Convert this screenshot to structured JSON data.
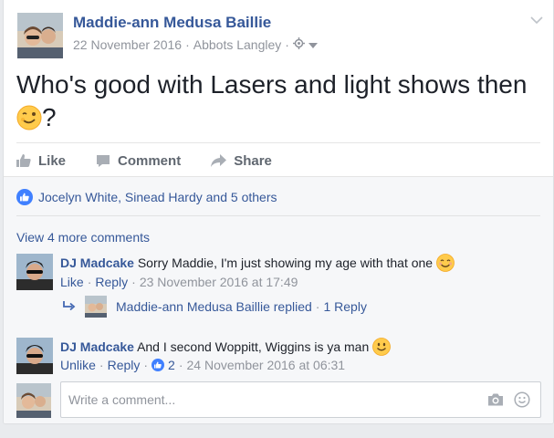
{
  "post": {
    "author": "Maddie-ann Medusa Baillie",
    "date": "22 November 2016",
    "location": "Abbots Langley",
    "separator": "·",
    "text": "Who's good with Lasers and light shows then",
    "text_suffix": "?"
  },
  "actions": {
    "like_label": "Like",
    "comment_label": "Comment",
    "share_label": "Share"
  },
  "feedback": {
    "likers": "Jocelyn White, Sinead Hardy and 5 others",
    "more_comments": "View 4 more comments"
  },
  "comments": [
    {
      "author": "DJ Madcake",
      "text": "Sorry Maddie, I'm just showing my age with that one",
      "like_label": "Like",
      "reply_label": "Reply",
      "timestamp": "23 November 2016 at 17:49",
      "reply_summary": {
        "text": "Maddie-ann Medusa Baillie replied",
        "count_label": "1 Reply"
      }
    },
    {
      "author": "DJ Madcake",
      "text": "And I second Woppitt, Wiggins is ya man",
      "like_label": "Unlike",
      "reply_label": "Reply",
      "likes_count": "2",
      "timestamp": "24 November 2016 at 06:31"
    }
  ],
  "composer": {
    "placeholder": "Write a comment..."
  },
  "colors": {
    "link": "#365899",
    "like_blue": "#4080ff",
    "muted": "#90949c",
    "background": "#e9ebee"
  },
  "icons": [
    "globe-icon",
    "chevron-down-icon",
    "thumbs-up-icon",
    "comment-icon",
    "share-icon",
    "like-badge-icon",
    "reply-arrow-icon",
    "camera-icon",
    "emoji-icon",
    "wink-emoji-icon",
    "smile-emoji-icon"
  ]
}
